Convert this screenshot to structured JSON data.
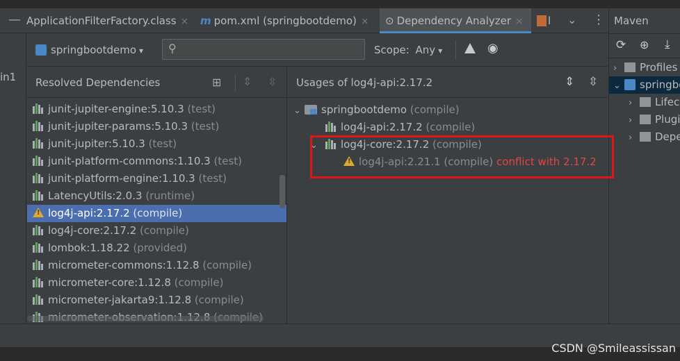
{
  "tabs": [
    {
      "label": "ApplicationFilterFactory.class",
      "close": "×"
    },
    {
      "label": "pom.xml (springbootdemo)",
      "close": "×",
      "icon": "m-icon"
    },
    {
      "label": "Dependency Analyzer",
      "close": "×",
      "active": true
    },
    {
      "label": "l",
      "close": ""
    }
  ],
  "gutter_text": "in1",
  "toolbar": {
    "project": "springbootdemo",
    "search_placeholder": "",
    "scope_label": "Scope:",
    "scope_value": "Any"
  },
  "left_panel": {
    "title": "Resolved Dependencies",
    "items": [
      {
        "name": "junit-jupiter-engine:5.10.3",
        "scope": "(test)"
      },
      {
        "name": "junit-jupiter-params:5.10.3",
        "scope": "(test)"
      },
      {
        "name": "junit-jupiter:5.10.3",
        "scope": "(test)"
      },
      {
        "name": "junit-platform-commons:1.10.3",
        "scope": "(test)"
      },
      {
        "name": "junit-platform-engine:1.10.3",
        "scope": "(test)"
      },
      {
        "name": "LatencyUtils:2.0.3",
        "scope": "(runtime)"
      },
      {
        "name": "log4j-api:2.17.2",
        "scope": "(compile)",
        "selected": true,
        "warning": true
      },
      {
        "name": "log4j-core:2.17.2",
        "scope": "(compile)"
      },
      {
        "name": "lombok:1.18.22",
        "scope": "(provided)"
      },
      {
        "name": "micrometer-commons:1.12.8",
        "scope": "(compile)"
      },
      {
        "name": "micrometer-core:1.12.8",
        "scope": "(compile)"
      },
      {
        "name": "micrometer-jakarta9:1.12.8",
        "scope": "(compile)"
      },
      {
        "name": "micrometer-observation:1.12.8",
        "scope": "(compile)"
      }
    ]
  },
  "right_panel": {
    "title": "Usages of log4j-api:2.17.2",
    "root": {
      "name": "springbootdemo",
      "scope": "(compile)"
    },
    "child1": {
      "name": "log4j-api:2.17.2",
      "scope": "(compile)"
    },
    "child2": {
      "name": "log4j-core:2.17.2",
      "scope": "(compile)"
    },
    "grandchild": {
      "name": "log4j-api:2.21.1",
      "scope": "(compile)",
      "conflict": "conflict with 2.17.2"
    }
  },
  "maven": {
    "title": "Maven",
    "items": [
      {
        "label": "Profiles"
      },
      {
        "label": "springbootdemo",
        "selected": true
      },
      {
        "label": "Lifecycle"
      },
      {
        "label": "Plugins"
      },
      {
        "label": "Dependencies"
      }
    ]
  },
  "watermark": "CSDN @Smileassissan",
  "colors": {
    "accent": "#4a88c7",
    "selection": "#4b6eaf",
    "conflict": "#e0483e",
    "highlight_box": "#e01616"
  }
}
